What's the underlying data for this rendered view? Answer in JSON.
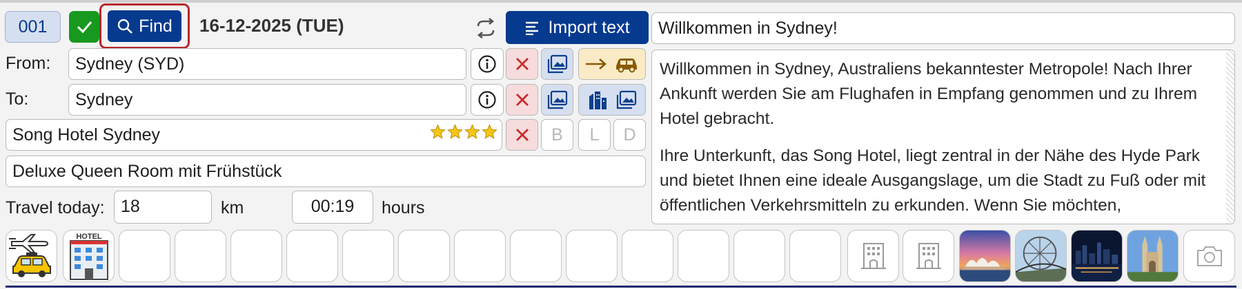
{
  "header": {
    "day_number": "001",
    "find_label": "Find",
    "date": "16-12-2025 (TUE)",
    "import_label": "Import text"
  },
  "route": {
    "from_label": "From:",
    "from_value": "Sydney (SYD)",
    "to_label": "To:",
    "to_value": "Sydney"
  },
  "hotel": {
    "name": "Song Hotel Sydney",
    "stars": 4,
    "room": "Deluxe Queen Room mit Frühstück",
    "meals": [
      "B",
      "L",
      "D"
    ]
  },
  "travel": {
    "label": "Travel today:",
    "distance": "18",
    "distance_unit": "km",
    "duration": "00:19",
    "duration_unit": "hours"
  },
  "description": {
    "title": "Willkommen in Sydney!",
    "paragraphs": [
      "Willkommen in Sydney, Australiens bekanntester Metropole! Nach Ihrer Ankunft werden Sie am Flughafen in Empfang genommen und zu Ihrem Hotel gebracht.",
      "Ihre Unterkunft, das Song Hotel, liegt zentral in der Nähe des Hyde Park und bietet Ihnen eine ideale Ausgangslage, um die Stadt zu Fuß oder mit öffentlichen Verkehrsmitteln zu erkunden. Wenn Sie möchten,"
    ]
  },
  "tiles": {
    "hotel_icon_text": "HOTEL",
    "icons": [
      "airport-transfer-icon",
      "hotel-icon",
      "building-placeholder-icon",
      "photo-opera-house",
      "photo-ferris-wheel",
      "photo-night-skyline",
      "photo-cathedral",
      "camera-icon"
    ]
  },
  "colors": {
    "primary": "#063a8f",
    "confirm_green": "#17991f",
    "highlight_red": "#b8262b",
    "delete_red": "#cc2b2b",
    "bottom_rule": "#1d2a6e"
  }
}
